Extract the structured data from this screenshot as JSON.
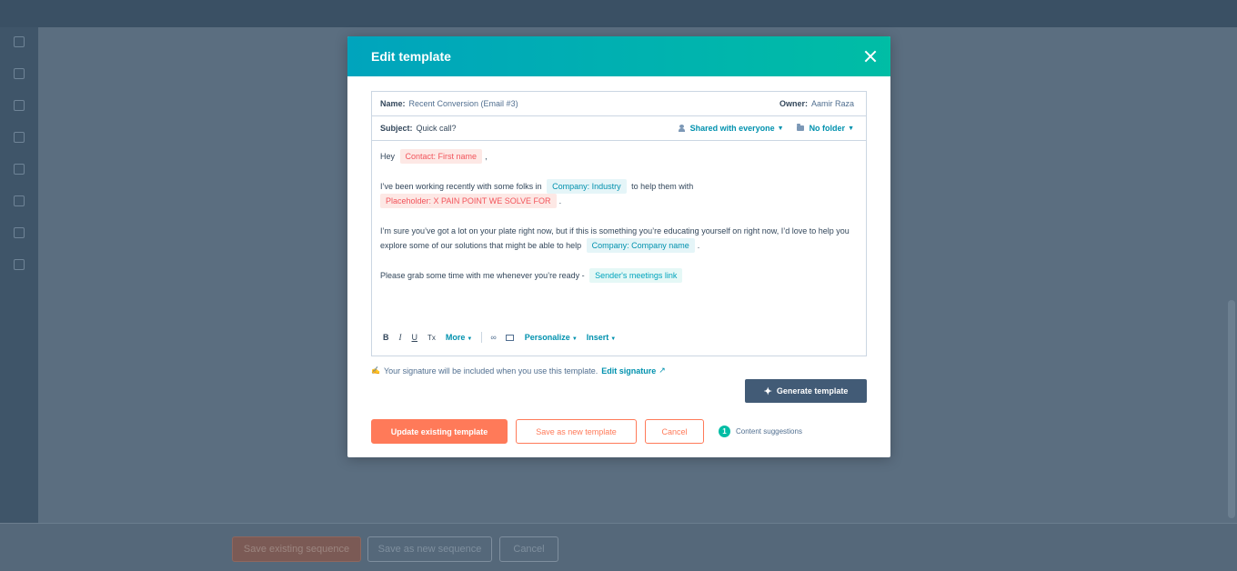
{
  "background": {
    "footer": {
      "save_existing": "Save existing sequence",
      "save_new": "Save as new sequence",
      "cancel": "Cancel"
    }
  },
  "modal": {
    "title": "Edit template",
    "name_label": "Name:",
    "name_value": "Recent Conversion (Email #3)",
    "owner_label": "Owner:",
    "owner_value": "Aamir Raza",
    "subject_label": "Subject:",
    "subject_value": "Quick call?",
    "shared": "Shared with everyone",
    "folder": "No folder",
    "body": {
      "greeting": "Hey",
      "token_first_name": "Contact: First name",
      "greeting_end": ",",
      "p2_a": "I’ve been working recently with some folks in",
      "token_industry": "Company: Industry",
      "p2_b": "to help them with",
      "token_placeholder": "Placeholder: X PAIN POINT WE SOLVE FOR",
      "p2_end": ".",
      "p3_a": "I’m sure you’ve got a lot on your plate right now, but if this is something you’re educating yourself on right now, I’d love to help you explore some of our solutions that might be able to help",
      "token_company": "Company: Company name",
      "p3_end": ".",
      "p4_a": "Please grab some time with me whenever you’re ready -",
      "token_meetings": "Sender's meetings link"
    },
    "toolbar": {
      "bold": "B",
      "italic": "I",
      "underline": "U",
      "clear": "Tx",
      "more": "More",
      "personalize": "Personalize",
      "insert": "Insert"
    },
    "signature_text": "Your signature will be included when you use this template.",
    "edit_signature": "Edit signature",
    "generate_button": "Generate template",
    "update_button": "Update existing template",
    "save_new_button": "Save as new template",
    "cancel_button": "Cancel",
    "suggestions_count": "1",
    "suggestions_label": "Content suggestions"
  }
}
